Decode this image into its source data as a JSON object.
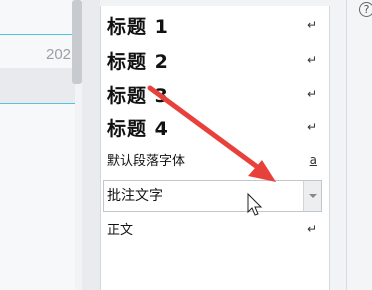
{
  "document": {
    "year_fragment": "202"
  },
  "styles": {
    "items": [
      {
        "label": "标题  1",
        "mark": "↵"
      },
      {
        "label": "标题  2",
        "mark": "↵"
      },
      {
        "label": "标题  3",
        "mark": "↵"
      },
      {
        "label": "标题  4",
        "mark": "↵"
      },
      {
        "label": "默认段落字体",
        "mark": "a"
      },
      {
        "label": "批注文字"
      },
      {
        "label": "正文",
        "mark": "↵"
      }
    ]
  },
  "toolbar": {
    "help_glyph": "?"
  },
  "colors": {
    "accent_line": "#4fc4e2",
    "annotation_arrow": "#e8413b"
  }
}
